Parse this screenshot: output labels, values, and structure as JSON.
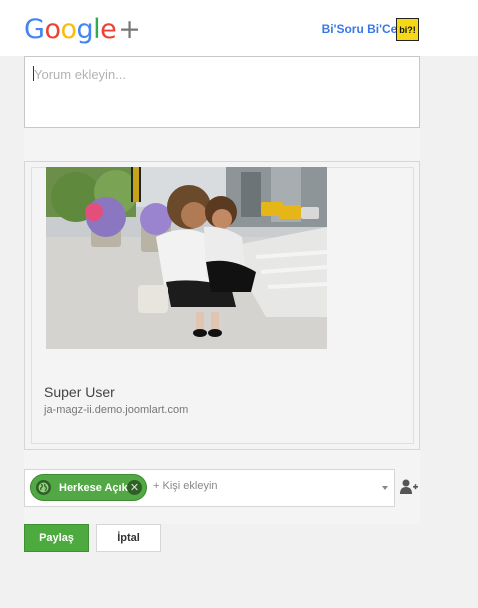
{
  "header": {
    "logo_parts": [
      "G",
      "o",
      "o",
      "g",
      "l",
      "e"
    ],
    "logo_plus": "+",
    "brand_name": "Bi'Soru Bi'Cevap",
    "brand_badge": "bi?!",
    "colors": {
      "blue": "#4285f4",
      "red": "#ea4335",
      "yellow": "#fbbc05",
      "green": "#34a853",
      "brand": "#3b78e7"
    }
  },
  "comment": {
    "placeholder": "Yorum ekleyin..."
  },
  "share_card": {
    "author": "Super User",
    "site": "ja-magz-ii.demo.joomlart.com"
  },
  "audience": {
    "chip_label": "Herkese Açık",
    "chip_icon": "globe-icon",
    "remove_icon": "close-icon",
    "add_placeholder": "+ Kişi ekleyin",
    "accent": "#52a844"
  },
  "actions": {
    "share_label": "Paylaş",
    "cancel_label": "İptal"
  }
}
